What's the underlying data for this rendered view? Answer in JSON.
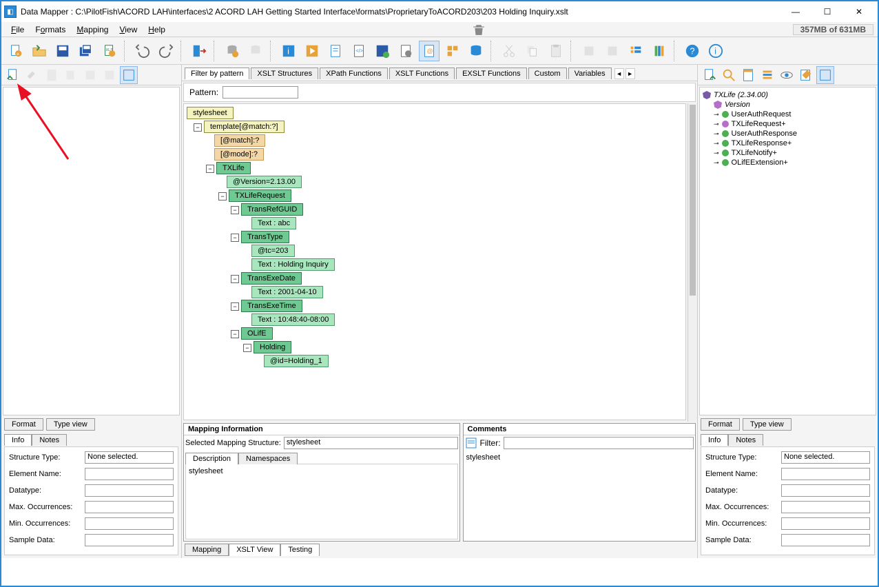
{
  "window": {
    "title": "Data Mapper : C:\\PilotFish\\ACORD LAH\\interfaces\\2 ACORD LAH Getting Started Interface\\formats\\ProprietaryToACORD203\\203 Holding Inquiry.xslt"
  },
  "menu": {
    "file": "File",
    "formats": "Formats",
    "mapping": "Mapping",
    "view": "View",
    "help": "Help",
    "memory": "357MB of 631MB"
  },
  "centerTabs": {
    "filter": "Filter by pattern",
    "xsltS": "XSLT Structures",
    "xpath": "XPath Functions",
    "xsltF": "XSLT Functions",
    "exslt": "EXSLT Functions",
    "custom": "Custom",
    "vars": "Variables"
  },
  "pattern": {
    "label": "Pattern:"
  },
  "canvas": {
    "stylesheet": "stylesheet",
    "template": "template[@match:?]",
    "match": "[@match]:?",
    "mode": "[@mode]:?",
    "txlife": "TXLife",
    "version": "@Version=2.13.00",
    "txreq": "TXLifeRequest",
    "refguid": "TransRefGUID",
    "textabc": "Text : abc",
    "transtype": "TransType",
    "tc203": "@tc=203",
    "texthold": "Text : Holding Inquiry",
    "exedate": "TransExeDate",
    "textdate": "Text : 2001-04-10",
    "exetime": "TransExeTime",
    "texttime": "Text : 10:48:40-08:00",
    "olife": "OLifE",
    "holding": "Holding",
    "idhold": "@id=Holding_1"
  },
  "rightTree": {
    "root": "TXLife (2.34.00)",
    "items": [
      "Version",
      "UserAuthRequest",
      "TXLifeRequest+",
      "UserAuthResponse",
      "TXLifeResponse+",
      "TXLifeNotify+",
      "OLifEExtension+"
    ]
  },
  "ftv": {
    "format": "Format",
    "typeview": "Type view",
    "info": "Info",
    "notes": "Notes"
  },
  "info": {
    "structType": "Structure Type:",
    "structTypeVal": "None selected.",
    "elemName": "Element Name:",
    "datatype": "Datatype:",
    "maxOcc": "Max. Occurrences:",
    "minOcc": "Min. Occurrences:",
    "sample": "Sample Data:"
  },
  "mapInfo": {
    "title": "Mapping Information",
    "selLabel": "Selected Mapping Structure:",
    "selVal": "stylesheet",
    "desc": "Description",
    "ns": "Namespaces",
    "descVal": "stylesheet"
  },
  "comments": {
    "title": "Comments",
    "filter": "Filter:",
    "item": "stylesheet"
  },
  "bottomTabs": {
    "mapping": "Mapping",
    "xsltview": "XSLT View",
    "testing": "Testing"
  }
}
